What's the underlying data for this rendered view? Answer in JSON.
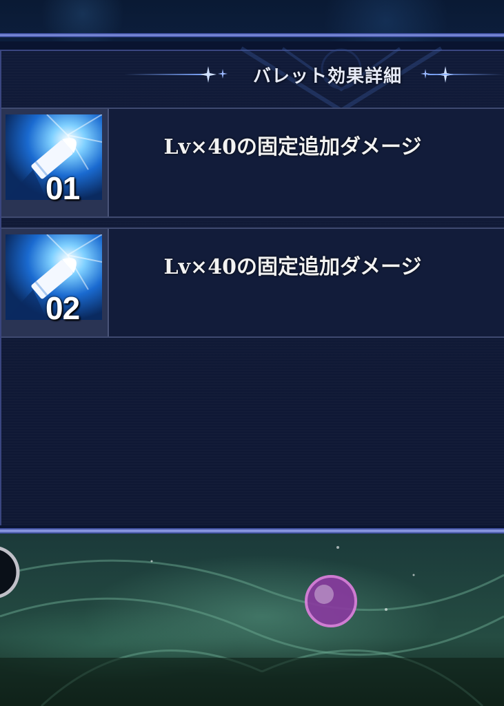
{
  "dialog": {
    "title": "バレット効果詳細"
  },
  "bullets": [
    {
      "number": "01",
      "effect": "Lv×40の固定追加ダメージ"
    },
    {
      "number": "02",
      "effect": "Lv×40の固定追加ダメージ"
    }
  ],
  "colors": {
    "accent_bar": "#8a9ae8",
    "panel_bg": "#101a38",
    "icon_glow": "#3aa0ff",
    "field_orb_pink": "#d060d0",
    "field_orb_cyan": "#50c0d0"
  },
  "icons": {
    "bullet_icon": "bullet-icon",
    "header_sparkle": "sparkle-icon",
    "orb": "orb-icon",
    "crescent": "crescent-icon"
  }
}
